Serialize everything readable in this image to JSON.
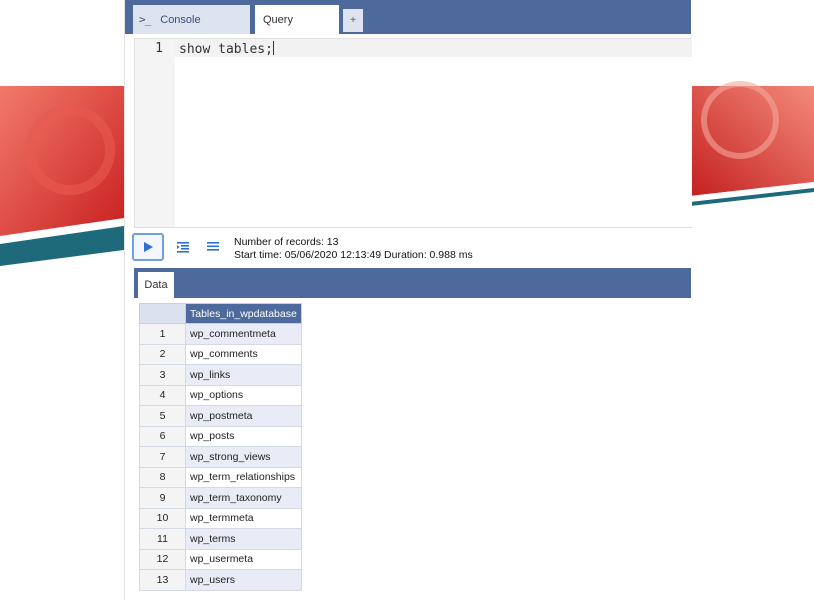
{
  "tabs": {
    "console_label": "Console",
    "query_label": "Query",
    "add_label": "+"
  },
  "editor": {
    "line_number": "1",
    "code": "show tables;"
  },
  "toolbar": {
    "records_text": "Number of records: 13",
    "timing_text": "Start time: 05/06/2020 12:13:49 Duration: 0.988 ms"
  },
  "data_tab": {
    "label": "Data"
  },
  "results": {
    "column_header": "Tables_in_wpdatabase",
    "rows": [
      {
        "num": "1",
        "value": "wp_commentmeta"
      },
      {
        "num": "2",
        "value": "wp_comments"
      },
      {
        "num": "3",
        "value": "wp_links"
      },
      {
        "num": "4",
        "value": "wp_options"
      },
      {
        "num": "5",
        "value": "wp_postmeta"
      },
      {
        "num": "6",
        "value": "wp_posts"
      },
      {
        "num": "7",
        "value": "wp_strong_views"
      },
      {
        "num": "8",
        "value": "wp_term_relationships"
      },
      {
        "num": "9",
        "value": "wp_term_taxonomy"
      },
      {
        "num": "10",
        "value": "wp_termmeta"
      },
      {
        "num": "11",
        "value": "wp_terms"
      },
      {
        "num": "12",
        "value": "wp_usermeta"
      },
      {
        "num": "13",
        "value": "wp_users"
      }
    ]
  },
  "colors": {
    "header_blue": "#4e6a9c",
    "decor_red": "#d42a2a",
    "decor_teal": "#1f6a7a"
  }
}
